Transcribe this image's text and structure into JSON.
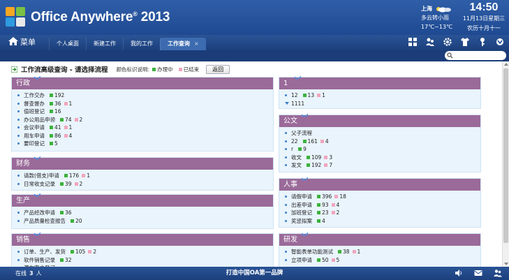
{
  "header": {
    "app_name": "Office Anywhere",
    "reg": "®",
    "year": "2013",
    "weather": {
      "city": "上海",
      "condition": "多云转小雨",
      "temp": "17℃~13℃"
    },
    "clock": {
      "time": "14:50",
      "date": "11月13日星期三",
      "lunar": "农历十月十一"
    }
  },
  "nav": {
    "menu_label": "菜单",
    "tabs": [
      {
        "label": "个人桌面"
      },
      {
        "label": "新建工作"
      },
      {
        "label": "我的工作"
      },
      {
        "label": "工作查询",
        "close": "×"
      }
    ]
  },
  "main": {
    "title": "工作流高级查询 - 请选择流程",
    "legend_label": "颜色标识说明:",
    "legend_active": "办理中",
    "legend_done": "已结束",
    "back_label": "返回",
    "colors": {
      "active": "#3bb23b",
      "done": "#f2a6bd",
      "header": "#9a6a99"
    }
  },
  "left_cards": [
    {
      "title": "行政",
      "rows": [
        {
          "name": "工作交办",
          "g": "192",
          "p": ""
        },
        {
          "name": "督查督办",
          "g": "36",
          "p": "1"
        },
        {
          "name": "值班登记",
          "g": "16",
          "p": ""
        },
        {
          "name": "办公用品申领",
          "g": "74",
          "p": "2"
        },
        {
          "name": "会议申请",
          "g": "41",
          "p": "1"
        },
        {
          "name": "用车申请",
          "g": "86",
          "p": "4"
        },
        {
          "name": "要印登记",
          "g": "5",
          "p": ""
        }
      ]
    },
    {
      "title": "财务",
      "rows": [
        {
          "name": "请款(借支)申请",
          "g": "176",
          "p": "1"
        },
        {
          "name": "日常收支记录",
          "g": "39",
          "p": "2"
        }
      ]
    },
    {
      "title": "生产",
      "rows": [
        {
          "name": "产品经改申请",
          "g": "36",
          "p": ""
        },
        {
          "name": "产品质量检查报告",
          "g": "20",
          "p": ""
        }
      ]
    },
    {
      "title": "销售",
      "rows": [
        {
          "name": "订单、生产、发货",
          "g": "105",
          "p": "2"
        },
        {
          "name": "软件销售记录",
          "g": "32",
          "p": ""
        },
        {
          "name": "潜在客户登记",
          "g": "",
          "p": ""
        }
      ]
    }
  ],
  "right_cards": [
    {
      "title": "1",
      "rows": [
        {
          "name": "12",
          "g": "13",
          "p": "1",
          "marker": "dot"
        },
        {
          "name": "1111",
          "g": "",
          "p": "",
          "marker": "tri"
        }
      ]
    },
    {
      "title": "公文",
      "rows": [
        {
          "name": "父子流程",
          "g": "",
          "p": ""
        },
        {
          "name": "22",
          "g": "161",
          "p": "4"
        },
        {
          "name": "r",
          "g": "9",
          "p": ""
        },
        {
          "name": "收文",
          "g": "109",
          "p": "3"
        },
        {
          "name": "发文",
          "g": "192",
          "p": "7"
        }
      ]
    },
    {
      "title": "人事",
      "rows": [
        {
          "name": "请假申请",
          "g": "396",
          "p": "18"
        },
        {
          "name": "出差申请",
          "g": "93",
          "p": "4"
        },
        {
          "name": "加班登记",
          "g": "23",
          "p": "2"
        },
        {
          "name": "奖惩拟案",
          "g": "4",
          "p": ""
        }
      ]
    },
    {
      "title": "研发",
      "rows": [
        {
          "name": "智能表单功能测试",
          "g": "38",
          "p": "1"
        },
        {
          "name": "立项申请",
          "g": "50",
          "p": "5"
        }
      ]
    }
  ],
  "footer": {
    "online_prefix": "在线",
    "online_count": "3",
    "online_suffix": "人",
    "slogan": "打造中国OA第一品牌"
  }
}
